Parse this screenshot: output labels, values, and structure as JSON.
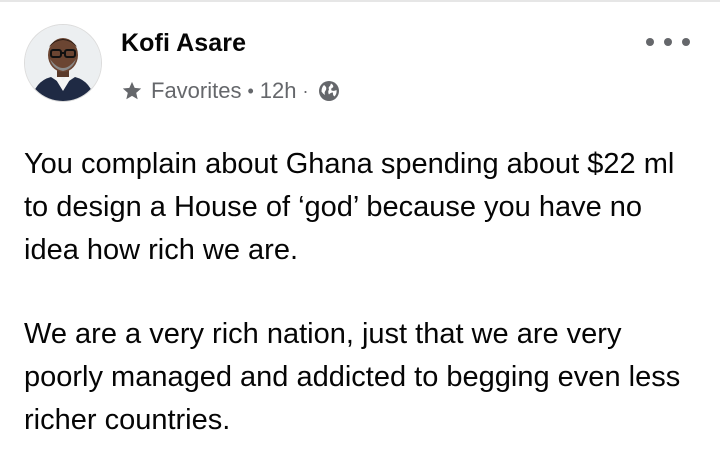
{
  "post": {
    "author": "Kofi Asare",
    "audience": "Favorites",
    "meta_separator": "•",
    "time": "12h",
    "time_separator": "·",
    "icons": {
      "audience": "star-icon",
      "privacy": "globe-icon",
      "more": "more-options-icon",
      "avatar": "avatar-photo"
    },
    "paragraphs": [
      "You complain about Ghana spending about $22 ml to design a House of ‘god’ because you have no idea how rich we are.",
      "We are a very rich nation, just that we are very poorly managed and addicted to begging even less richer countries."
    ]
  },
  "colors": {
    "text": "#050505",
    "secondary": "#65676b",
    "background": "#ffffff"
  }
}
